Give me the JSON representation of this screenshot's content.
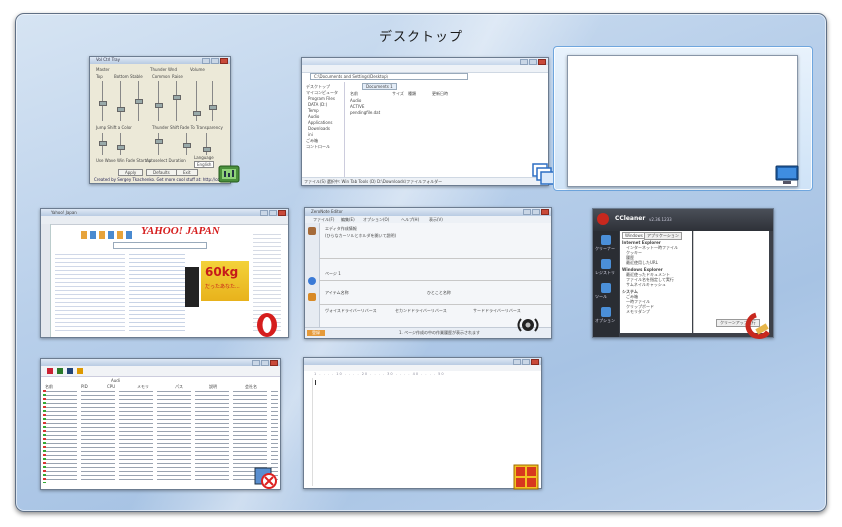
{
  "flip3d": {
    "title": "デスクトップ"
  },
  "windows": {
    "volume": {
      "title": "Vol Ctrl Tray",
      "sections": [
        "Master",
        "Thunder Wnd",
        "Balance",
        "Volume"
      ],
      "col_labels": [
        "Top",
        "Bottom",
        "Stable",
        "Common",
        "Raise"
      ],
      "rows": [
        "Jump Shift a Color",
        "Thunder Shift",
        "Fade To Transparency",
        "Fade Out into Transparency"
      ],
      "checkbox_1": "Use Wave Win Fade Startup",
      "checkbox_2": "Autoselect Duration",
      "language_label": "Language",
      "language_value": "English",
      "buttons": [
        "Apply",
        "Defaults",
        "Exit"
      ],
      "footer": "Created by Sergey Tkachenko. Get more cool stuff at: http://cool"
    },
    "explorer": {
      "address": "C:\\Documents and Settings\\Desktop\\",
      "tab": "Documents 1",
      "columns": [
        "名前",
        "サイズ",
        "種類",
        "更新日時"
      ],
      "files": [
        "Audio",
        "ACTIVE",
        "pendingfile.dat"
      ],
      "tree": [
        "デスクトップ",
        "マイコンピュータ",
        "Program Files",
        "DATA (D:)",
        "Temp",
        "Audio",
        "Applications",
        "Downloads",
        "ini",
        "ごみ箱",
        "コントロール"
      ],
      "status": "ファイル(S) 選択中: Win Tab Tools (D) D:\\Downloads\\ファイルフォルダー"
    },
    "opera": {
      "title": "Yahoo! Japan",
      "logo": "YAHOO! JAPAN",
      "banner": "60kg",
      "banner_sub": "だったあなた..."
    },
    "editor": {
      "title": "ZeroNote Editor",
      "menus": [
        "ファイル(F)",
        "編集(E)",
        "オプション(O)",
        "ヘルプ(H)",
        "表示(V)"
      ],
      "prompt": "エディタ作成情報",
      "prompt_detail": "(ひらなカーソルとホルダを開いて説明)",
      "section_label": "ページ 1",
      "fields": [
        "アイテム名称",
        "ひとこと名称",
        "ヴォイスドライバーリバース",
        "セカンドドライバーリバース",
        "サードドライバーリバース"
      ],
      "status_button": "登録",
      "status_text": "1. ページ作成の中の作業履歴が表示されます"
    },
    "ccleaner": {
      "title": "CCleaner",
      "version": "v2.36.1233",
      "sidebar": [
        "クリーナー",
        "レジストリ",
        "ツール",
        "オプション"
      ],
      "tabs": [
        "Windows",
        "アプリケーション"
      ],
      "items": [
        "Internet Explorer",
        "インターネット一時ファイル",
        "クッキー",
        "履歴",
        "最近使用したURL",
        "Windows Explorer",
        "最近使ったドキュメント",
        "ファイル名を指定して実行",
        "サムネイルキャッシュ",
        "システム",
        "ごみ箱",
        "一時ファイル",
        "クリップボード",
        "メモリダンプ"
      ],
      "button_run": "クリーンアップ実行"
    },
    "processlist": {
      "columns": [
        "名前",
        "PID",
        "CPU",
        "メモリ",
        "パス",
        "説明",
        "会社名"
      ],
      "header": "Audi"
    },
    "texteditor": {
      "ruler": "1 . . . . 10 . . . . 20 . . . . 30 . . . . 40 . . . . 50"
    }
  },
  "colors": {
    "opera_red": "#d51d1d",
    "ccleaner_red": "#c8281e",
    "explorer_blue": "#2d6fc4",
    "flip_bg": "#b8cfea"
  },
  "icons": {
    "volume": "volume-app-icon",
    "explorer": "explorer-windows-icon",
    "desktop": "desktop-monitor-icon",
    "opera": "opera-icon",
    "editor": "speaker-icon",
    "ccleaner": "ccleaner-brush-icon",
    "processlist": "process-uninstall-icon",
    "texteditor": "hidemaru-icon"
  }
}
